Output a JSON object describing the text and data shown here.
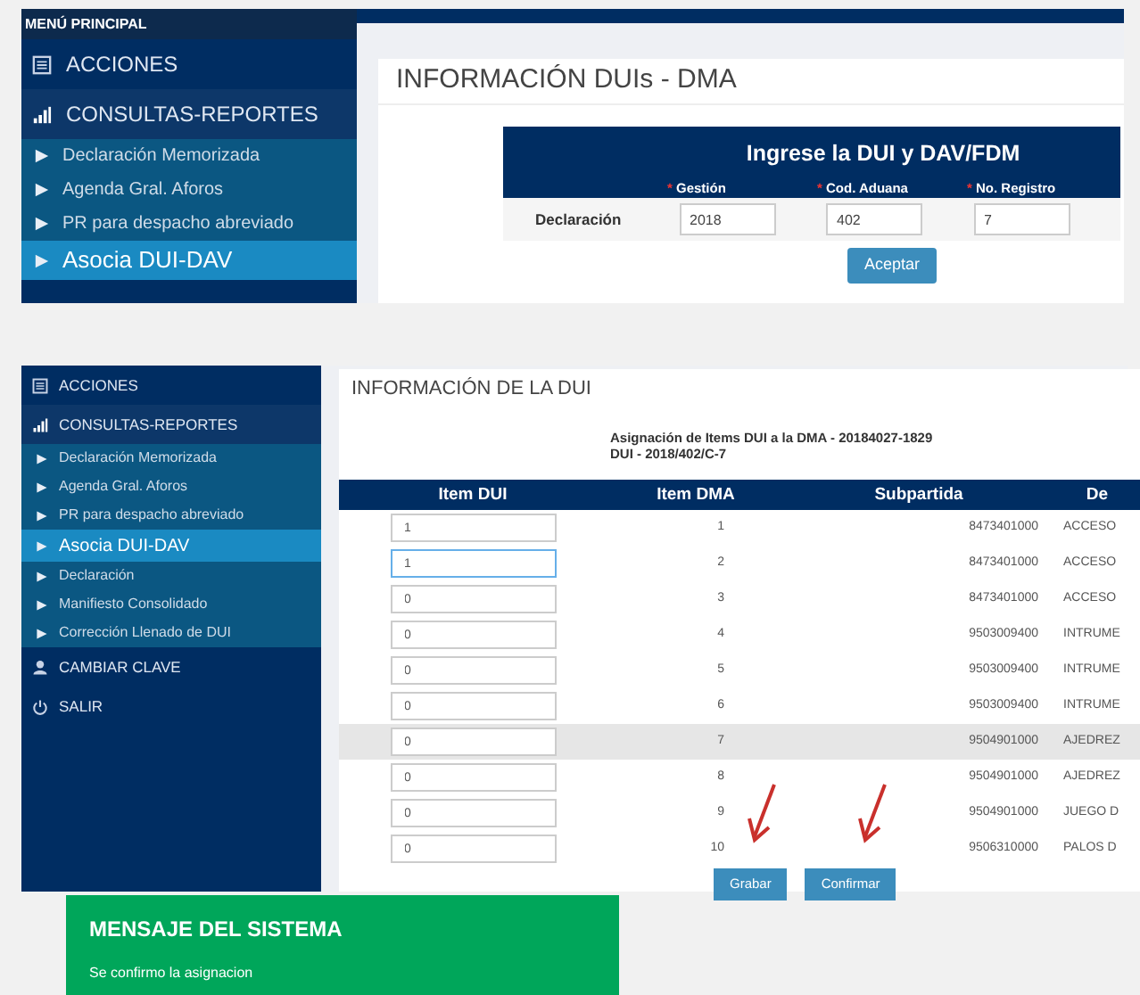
{
  "panel_1": {
    "menu_header": "MENÚ PRINCIPAL",
    "sidebar": [
      {
        "kind": "section",
        "label": "ACCIONES",
        "selected": false
      },
      {
        "kind": "section",
        "label": "CONSULTAS-REPORTES",
        "selected": false
      },
      {
        "kind": "item",
        "label": "Declaración Memorizada",
        "selected": false
      },
      {
        "kind": "item",
        "label": "Agenda Gral. Aforos",
        "selected": false
      },
      {
        "kind": "item",
        "label": "PR para despacho abreviado",
        "selected": false
      },
      {
        "kind": "item",
        "label": "Asocia DUI-DAV",
        "selected": true
      }
    ],
    "title": "INFORMACIÓN DUIs - DMA",
    "form": {
      "heading": "Ingrese la DUI y DAV/FDM",
      "row_label": "Declaración",
      "fields": [
        {
          "label": "Gestión",
          "value": "2018"
        },
        {
          "label": "Cod. Aduana",
          "value": "402"
        },
        {
          "label": "No. Registro",
          "value": "7"
        }
      ],
      "required_mark": "*",
      "button": "Aceptar"
    }
  },
  "panel_2": {
    "sidebar": [
      {
        "kind": "section",
        "label": "ACCIONES",
        "selected": false
      },
      {
        "kind": "section",
        "label": "CONSULTAS-REPORTES",
        "selected": false
      },
      {
        "kind": "item",
        "label": "Declaración Memorizada",
        "selected": false
      },
      {
        "kind": "item",
        "label": "Agenda Gral. Aforos",
        "selected": false
      },
      {
        "kind": "item",
        "label": "PR para despacho abreviado",
        "selected": false
      },
      {
        "kind": "item",
        "label": "Asocia DUI-DAV",
        "selected": true
      },
      {
        "kind": "item",
        "label": "Declaración",
        "selected": false
      },
      {
        "kind": "item",
        "label": "Manifiesto Consolidado",
        "selected": false
      },
      {
        "kind": "item",
        "label": "Corrección Llenado de DUI",
        "selected": false
      },
      {
        "kind": "section",
        "label": "CAMBIAR CLAVE",
        "selected": false
      },
      {
        "kind": "section",
        "label": "SALIR",
        "selected": false
      }
    ],
    "title": "INFORMACIÓN DE LA DUI",
    "caption": [
      "Asignación de Items DUI a la DMA - 20184027-1829",
      "DUI - 2018/402/C-7"
    ],
    "table": {
      "columns": [
        "Item DUI",
        "Item DMA",
        "Subpartida",
        "De"
      ],
      "rows": [
        {
          "item_dui": "1",
          "item_dma": "1",
          "subpartida": "8473401000",
          "description": "ACCESO",
          "focused": false,
          "selected": false
        },
        {
          "item_dui": "1",
          "item_dma": "2",
          "subpartida": "8473401000",
          "description": "ACCESO",
          "focused": true,
          "selected": false
        },
        {
          "item_dui": "0",
          "item_dma": "3",
          "subpartida": "8473401000",
          "description": "ACCESO",
          "focused": false,
          "selected": false
        },
        {
          "item_dui": "0",
          "item_dma": "4",
          "subpartida": "9503009400",
          "description": "INTRUME",
          "focused": false,
          "selected": false
        },
        {
          "item_dui": "0",
          "item_dma": "5",
          "subpartida": "9503009400",
          "description": "INTRUME",
          "focused": false,
          "selected": false
        },
        {
          "item_dui": "0",
          "item_dma": "6",
          "subpartida": "9503009400",
          "description": "INTRUME",
          "focused": false,
          "selected": false
        },
        {
          "item_dui": "0",
          "item_dma": "7",
          "subpartida": "9504901000",
          "description": "AJEDREZ",
          "focused": false,
          "selected": true
        },
        {
          "item_dui": "0",
          "item_dma": "8",
          "subpartida": "9504901000",
          "description": "AJEDREZ",
          "focused": false,
          "selected": false
        },
        {
          "item_dui": "0",
          "item_dma": "9",
          "subpartida": "9504901000",
          "description": "JUEGO D",
          "focused": false,
          "selected": false
        },
        {
          "item_dui": "0",
          "item_dma": "10",
          "subpartida": "9506310000",
          "description": "PALOS D",
          "focused": false,
          "selected": false
        }
      ]
    },
    "buttons": [
      "Grabar",
      "Confirmar"
    ]
  },
  "message": {
    "title": "MENSAJE DEL SISTEMA",
    "text": "Se confirmo la asignacion"
  }
}
